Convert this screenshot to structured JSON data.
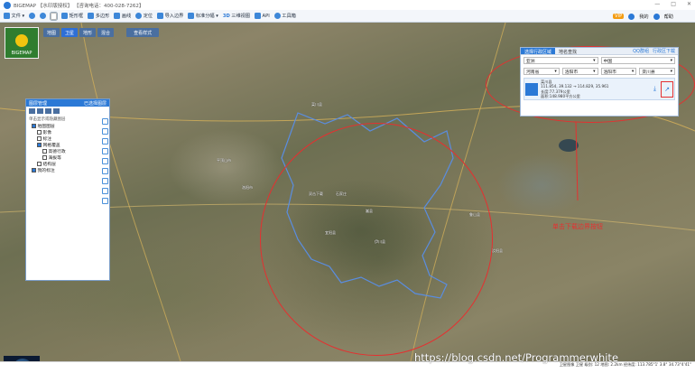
{
  "window": {
    "title": "BIGEMAP 【水印版授权】 【咨询电话：400-028-7262】"
  },
  "toolbar": {
    "items": [
      {
        "label": "文件 ▾",
        "icon": "file-icon"
      },
      {
        "label": "",
        "icon": "zoom-in-icon"
      },
      {
        "label": "",
        "icon": "zoom-out-icon"
      },
      {
        "label": "",
        "icon": "hand-icon"
      },
      {
        "label": "矩形框",
        "icon": "rectangle-icon"
      },
      {
        "label": "多边形",
        "icon": "polygon-icon"
      },
      {
        "label": "画线",
        "icon": "line-icon"
      },
      {
        "label": "定位",
        "icon": "location-icon"
      },
      {
        "label": "导入边界",
        "icon": "import-icon"
      },
      {
        "label": "标准分幅 ▾",
        "icon": "grid-icon"
      },
      {
        "label": "三维视图",
        "icon": "3d-icon"
      },
      {
        "label": "API",
        "icon": "api-icon"
      },
      {
        "label": "工具箱",
        "icon": "toolbox-icon"
      }
    ],
    "right": {
      "vip_label": "VIP",
      "user_label": "我的",
      "help_label": "帮助"
    }
  },
  "map_modes": {
    "modes": [
      "地图",
      "卫星",
      "地形",
      "混合"
    ],
    "active": 1,
    "extra": "查看样式"
  },
  "brand": {
    "label": "BIGEMAP"
  },
  "layer_panel": {
    "title": "图层管理",
    "action": "已选择图层",
    "hint": "单击显示或隐藏图层",
    "tree": [
      {
        "label": "地图图层",
        "checked": true,
        "depth": 0
      },
      {
        "label": "影像",
        "checked": false,
        "depth": 1
      },
      {
        "label": "标注",
        "checked": false,
        "depth": 1
      },
      {
        "label": "网格覆盖",
        "checked": true,
        "depth": 1
      },
      {
        "label": "高德行政",
        "checked": false,
        "depth": 2
      },
      {
        "label": "海拔等",
        "checked": false,
        "depth": 2
      },
      {
        "label": "结构层",
        "checked": false,
        "depth": 1
      },
      {
        "label": "我的标注",
        "checked": true,
        "depth": 0
      }
    ]
  },
  "search_panel": {
    "tabs": [
      "选择行政区域",
      "地名查找"
    ],
    "active_tab": 0,
    "right_links": [
      "QQ群组",
      "行政区下载"
    ],
    "row1": [
      "亚洲",
      "中国"
    ],
    "row2": [
      "河南省",
      "洛阳市",
      "洛阳市",
      "栾川县"
    ],
    "result": {
      "name": "栾川县",
      "lines": [
        "111.854, 39.132 → 114.829, 35.961",
        "长度:77.379公里",
        "面积:148.980平方公里"
      ]
    }
  },
  "annotation": {
    "text": "单击下载边界按钮"
  },
  "places": [
    {
      "text": "平顶山市"
    },
    {
      "text": "洛阳市"
    },
    {
      "text": "嵩县"
    },
    {
      "text": "栾川县"
    },
    {
      "text": "汝阳县"
    },
    {
      "text": "宜阳县"
    },
    {
      "text": "伊川县"
    },
    {
      "text": "双击下载"
    },
    {
      "text": "石家庄"
    },
    {
      "text": "鲁山县"
    }
  ],
  "watermark": "https://blog.csdn.net/Programmerwhite",
  "status": {
    "text": "卫星图像 卫星 级别: 12  地图: 2.2km  经纬度: 113.785°1' 3.8°  34.73°4'41\""
  }
}
